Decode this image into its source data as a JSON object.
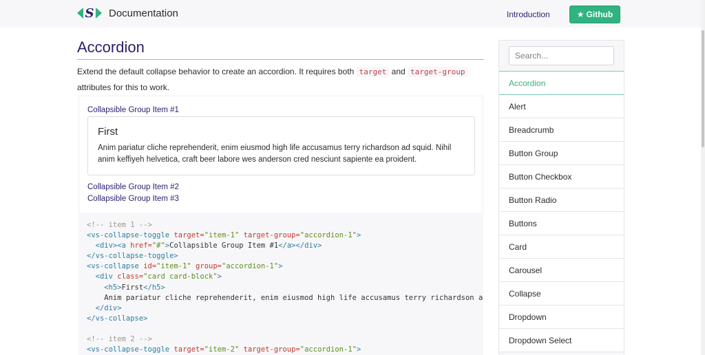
{
  "navbar": {
    "brand": "Documentation",
    "logo_letter": "S",
    "links": [
      "Introduction"
    ],
    "github_label": "Github",
    "github_color": "#2fb380"
  },
  "page": {
    "title": "Accordion",
    "intro_before": "Extend the default collapse behavior to create an accordion. It requires both ",
    "intro_code1": "target",
    "intro_mid": " and ",
    "intro_code2": "target-group",
    "intro_after": " attributes for this to work."
  },
  "example": {
    "items": [
      "Collapsible Group Item #1",
      "Collapsible Group Item #2",
      "Collapsible Group Item #3"
    ],
    "card_title": "First",
    "card_text": "Anim pariatur cliche reprehenderit, enim eiusmod high life accusamus terry richardson ad squid. Nihil anim keffiyeh helvetica, craft beer labore wes anderson cred nesciunt sapiente ea proident."
  },
  "code": {
    "l1": "<!-- item 1 -->",
    "l2a": "<vs-collapse-toggle",
    "l2b": " target=",
    "l2c": "\"item-1\"",
    "l2d": " target-group=",
    "l2e": "\"accordion-1\"",
    "l2f": ">",
    "l3a": "  <div><a",
    "l3b": " href=",
    "l3c": "\"#\"",
    "l3d": ">",
    "l3e": "Collapsible Group Item #1",
    "l3f": "</a></div>",
    "l4": "</vs-collapse-toggle>",
    "l5a": "<vs-collapse",
    "l5b": " id=",
    "l5c": "\"item-1\"",
    "l5d": " group=",
    "l5e": "\"accordion-1\"",
    "l5f": ">",
    "l6a": "  <div",
    "l6b": " class=",
    "l6c": "\"card card-block\"",
    "l6d": ">",
    "l7a": "    <h5>",
    "l7b": "First",
    "l7c": "</h5>",
    "l8": "    Anim pariatur cliche reprehenderit, enim eiusmod high life accusamus terry richardson a",
    "l9": "  </div>",
    "l10": "</vs-collapse>",
    "l11": "",
    "l12": "<!-- item 2 -->",
    "l13a": "<vs-collapse-toggle",
    "l13b": " target=",
    "l13c": "\"item-2\"",
    "l13d": " target-group=",
    "l13e": "\"accordion-1\"",
    "l13f": ">"
  },
  "sidebar": {
    "search_placeholder": "Search...",
    "items": [
      "Accordion",
      "Alert",
      "Breadcrumb",
      "Button Group",
      "Button Checkbox",
      "Button Radio",
      "Buttons",
      "Card",
      "Carousel",
      "Collapse",
      "Dropdown",
      "Dropdown Select"
    ],
    "active_index": 0
  }
}
